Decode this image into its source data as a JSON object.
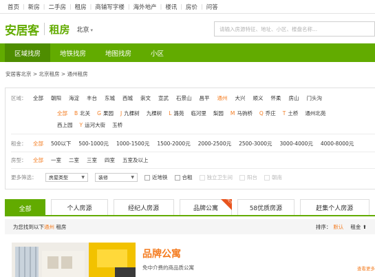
{
  "topnav": [
    "首页",
    "新房",
    "二手房",
    "租房",
    "商铺写字楼",
    "海外地产",
    "楼讯",
    "房价",
    "问答"
  ],
  "header": {
    "logo": "安居客",
    "section": "租房",
    "city": "北京",
    "search_placeholder": "请输入房源特征、地址、小区、楼盘名称..."
  },
  "greenbar": [
    "区域找房",
    "地铁找房",
    "地图找房",
    "小区"
  ],
  "breadcrumb": "安居客北京 > 北京租房 > 通州租房",
  "filters": {
    "area": {
      "label": "区域：",
      "options": [
        "全部",
        "朝阳",
        "海淀",
        "丰台",
        "东城",
        "西城",
        "崇文",
        "宣武",
        "石景山",
        "昌平",
        "通州",
        "大兴",
        "顺义",
        "怀柔",
        "房山",
        "门头沟"
      ],
      "active": "通州"
    },
    "subarea_row1": [
      {
        "letter": "",
        "name": "全部",
        "active": true
      },
      {
        "letter": "B",
        "name": "北关"
      },
      {
        "letter": "G",
        "name": "果园"
      },
      {
        "letter": "J",
        "name": "九棵树"
      },
      {
        "letter": "",
        "name": "九棵树"
      },
      {
        "letter": "L",
        "name": "潞苑"
      },
      {
        "letter": "",
        "name": "临河里"
      },
      {
        "letter": "",
        "name": "梨园"
      },
      {
        "letter": "M",
        "name": "马驹桥"
      },
      {
        "letter": "Q",
        "name": "乔庄"
      },
      {
        "letter": "T",
        "name": "土桥"
      },
      {
        "letter": "",
        "name": "通州北苑"
      }
    ],
    "subarea_row2": [
      {
        "letter": "",
        "name": "西上园"
      },
      {
        "letter": "Y",
        "name": "运河大街"
      },
      {
        "letter": "",
        "name": "玉桥"
      }
    ],
    "rent": {
      "label": "租金：",
      "options": [
        "全部",
        "500以下",
        "500-1000元",
        "1000-1500元",
        "1500-2000元",
        "2000-2500元",
        "2500-3000元",
        "3000-4000元",
        "4000-8000元"
      ],
      "active": "全部"
    },
    "rooms": {
      "label": "房型：",
      "options": [
        "全部",
        "一室",
        "二室",
        "三室",
        "四室",
        "五室及以上"
      ],
      "active": "全部"
    },
    "more": {
      "label": "更多筛选：",
      "select1": "房屋类型",
      "select2": "装修",
      "checkboxes": [
        {
          "label": "近地铁",
          "disabled": false
        },
        {
          "label": "合租",
          "disabled": false
        },
        {
          "label": "独立卫生间",
          "disabled": true
        },
        {
          "label": "阳台",
          "disabled": true
        },
        {
          "label": "朝南",
          "disabled": true
        }
      ]
    }
  },
  "cattabs": {
    "tabs": [
      "全部",
      "个人房源",
      "经纪人房源",
      "品牌公寓",
      "58优质房源",
      "赶集个人房源"
    ],
    "hot_badge": "HOT"
  },
  "result": {
    "prefix": "为您找到以下",
    "city": "通州",
    "suffix": "租房",
    "sort_label": "排序：",
    "sort_default": "默认",
    "sort_rent": "租金 ⬆"
  },
  "promo": {
    "title": "品牌公寓",
    "subtitle": "免中介费的商品质公寓",
    "right": "查看更多"
  },
  "colors": {
    "brand_green": "#62ab00",
    "accent_orange": "#f47c20"
  }
}
